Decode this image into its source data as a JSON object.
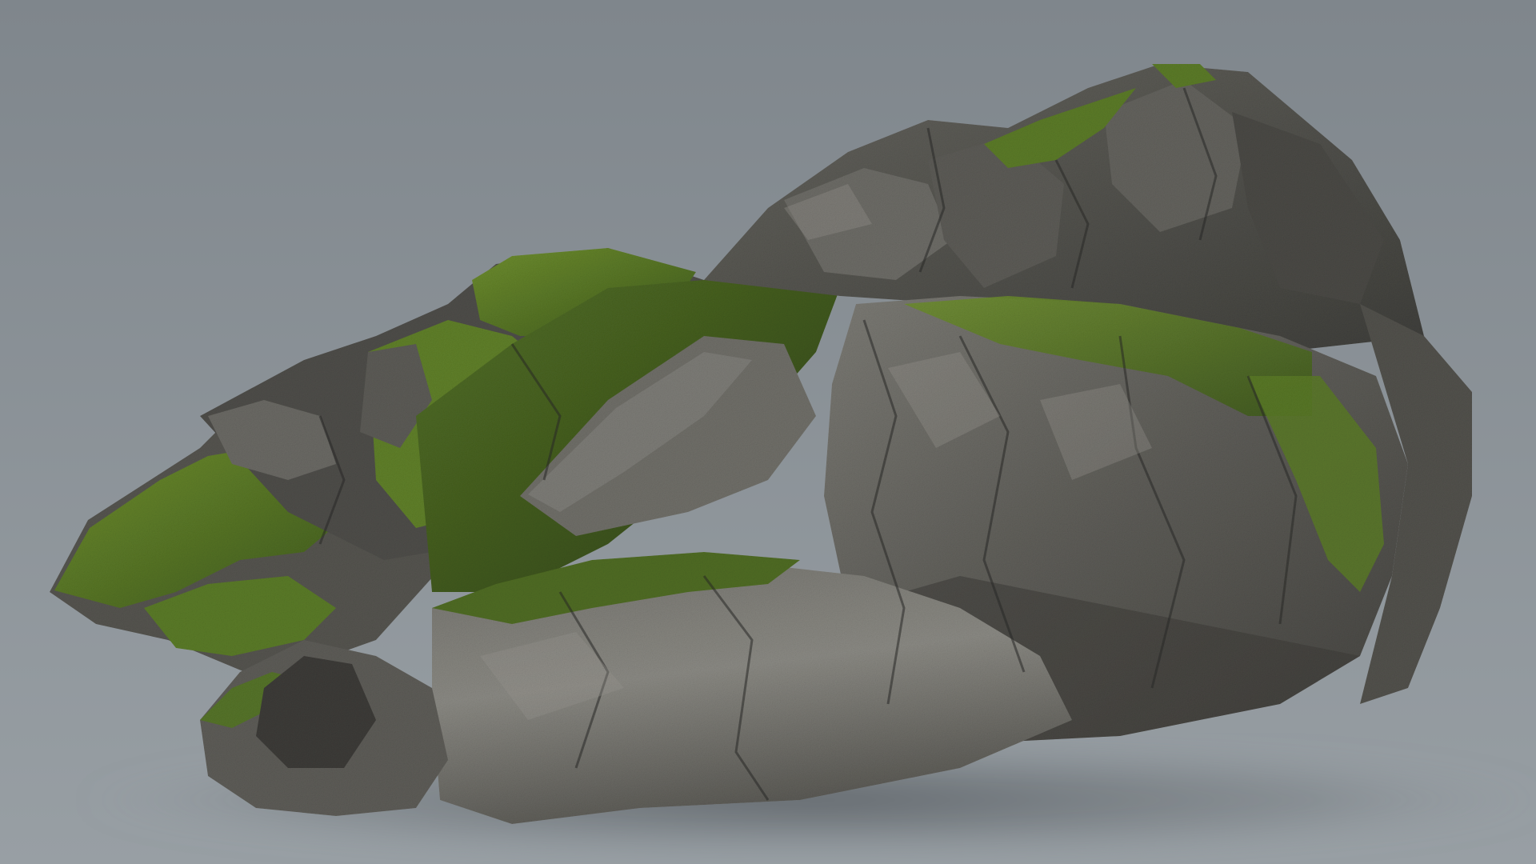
{
  "scene": {
    "subject": "moss-covered-rock-formation",
    "colors": {
      "background_top": "#7f868c",
      "background_bottom": "#979ea3",
      "rock_light": "#8a8983",
      "rock_mid": "#65645f",
      "rock_dark": "#3c3c39",
      "rock_shadow": "#2a2a28",
      "moss_light": "#6f8f2f",
      "moss_mid": "#4f6b23",
      "moss_dark": "#34481a",
      "ground_shadow": "#6b7176"
    }
  }
}
